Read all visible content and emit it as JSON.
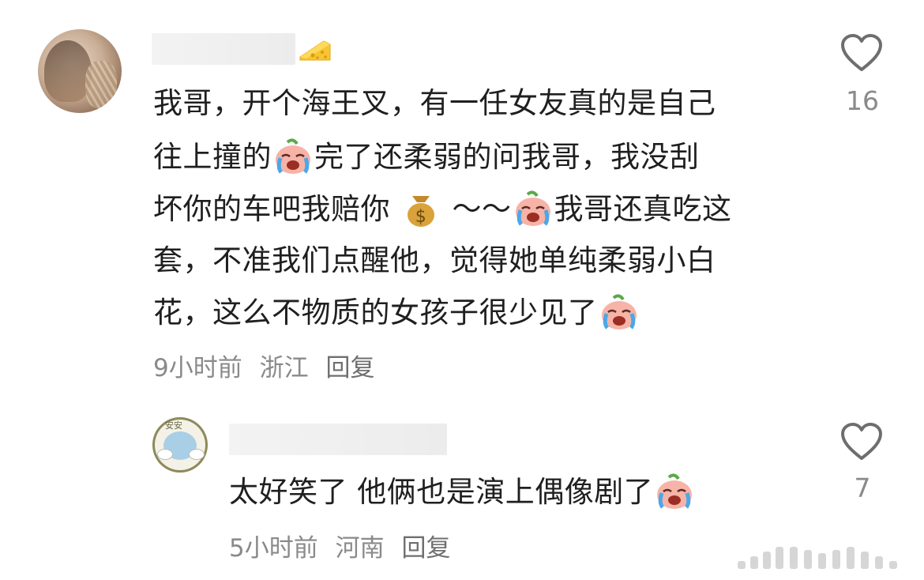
{
  "comments": [
    {
      "like_count": "16",
      "time": "9小时前",
      "location": "浙江",
      "reply_label": "回复",
      "lines": [
        {
          "a": "我哥，开个海王叉，有一任女友真的是自己"
        },
        {
          "a": "往上撞的",
          "b": "完了还柔弱的问我哥，我没刮"
        },
        {
          "a": "坏你的车吧我赔你",
          "c": "～～",
          "d": "我哥还真吃这"
        },
        {
          "a": "套，不准我们点醒他，觉得她单纯柔弱小白"
        },
        {
          "a": "花，这么不物质的女孩子很少见了"
        }
      ],
      "emoji_names": [
        "crying-laughing-peach-emoji",
        "money-bag-emoji"
      ],
      "badge": "cheese-icon"
    },
    {
      "like_count": "7",
      "time": "5小时前",
      "location": "河南",
      "reply_label": "回复",
      "text_a": "太好笑了 他俩也是演上偶像剧了",
      "avatar_tag": "安安"
    }
  ],
  "icons": {
    "like": "heart-outline-icon",
    "watermark": "signal-bars-icon"
  },
  "colors": {
    "text": "#1f1f1f",
    "meta": "#8a8a8a",
    "icon": "#6e6e6e"
  }
}
